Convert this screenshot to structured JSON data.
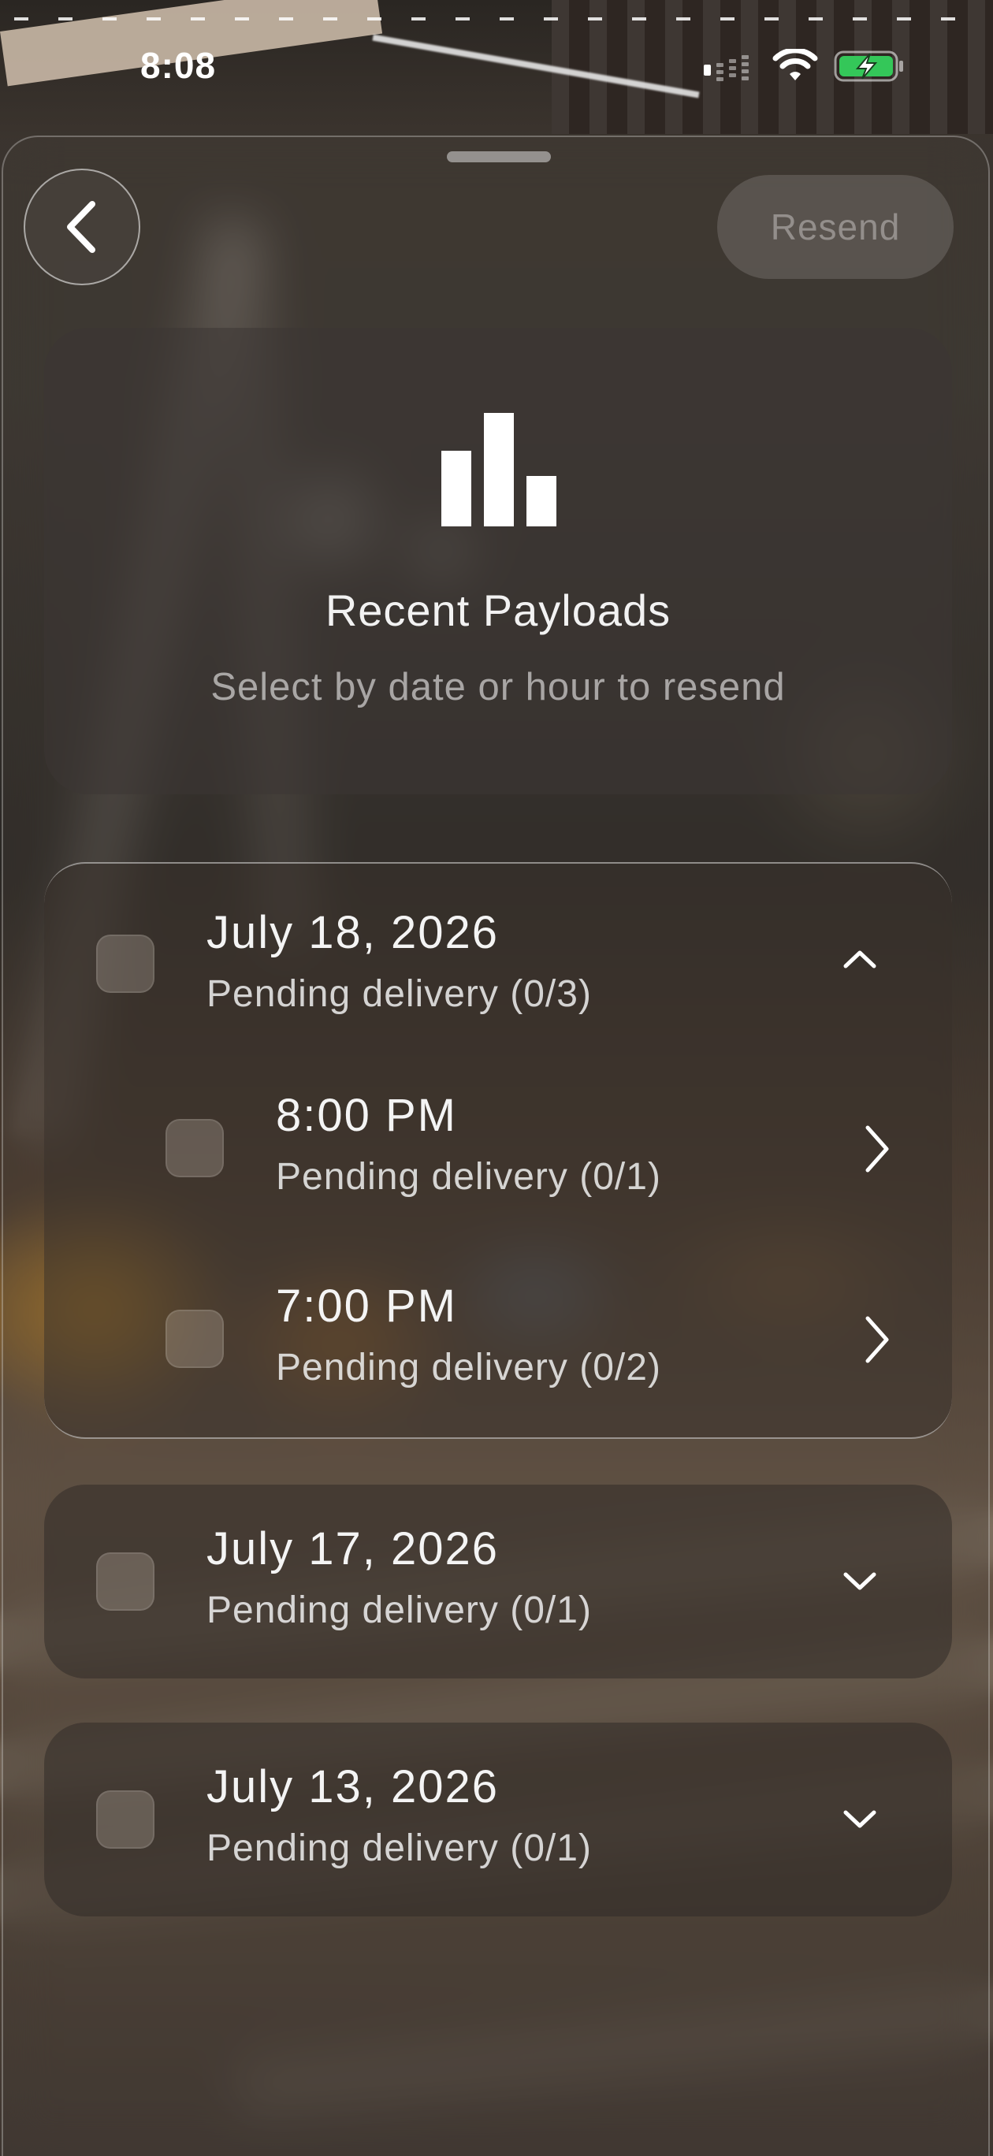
{
  "status_bar": {
    "time": "8:08"
  },
  "toolbar": {
    "resend_label": "Resend"
  },
  "header": {
    "title": "Recent Payloads",
    "subtitle": "Select by date or hour to resend"
  },
  "groups": [
    {
      "date": "July 18, 2026",
      "status": "Pending delivery (0/3)",
      "expanded": true,
      "hours": [
        {
          "time": "8:00 PM",
          "status": "Pending delivery (0/1)"
        },
        {
          "time": "7:00 PM",
          "status": "Pending delivery (0/2)"
        }
      ]
    },
    {
      "date": "July 17, 2026",
      "status": "Pending delivery (0/1)",
      "expanded": false
    },
    {
      "date": "July 13, 2026",
      "status": "Pending delivery (0/1)",
      "expanded": false
    }
  ],
  "colors": {
    "battery_fill": "#34c759",
    "text_primary": "#ffffff"
  },
  "icons": [
    "signal-icon",
    "wifi-icon",
    "battery-charging-icon",
    "chevron-left-icon",
    "bar-chart-icon",
    "chevron-up-icon",
    "chevron-right-icon",
    "chevron-down-icon"
  ]
}
